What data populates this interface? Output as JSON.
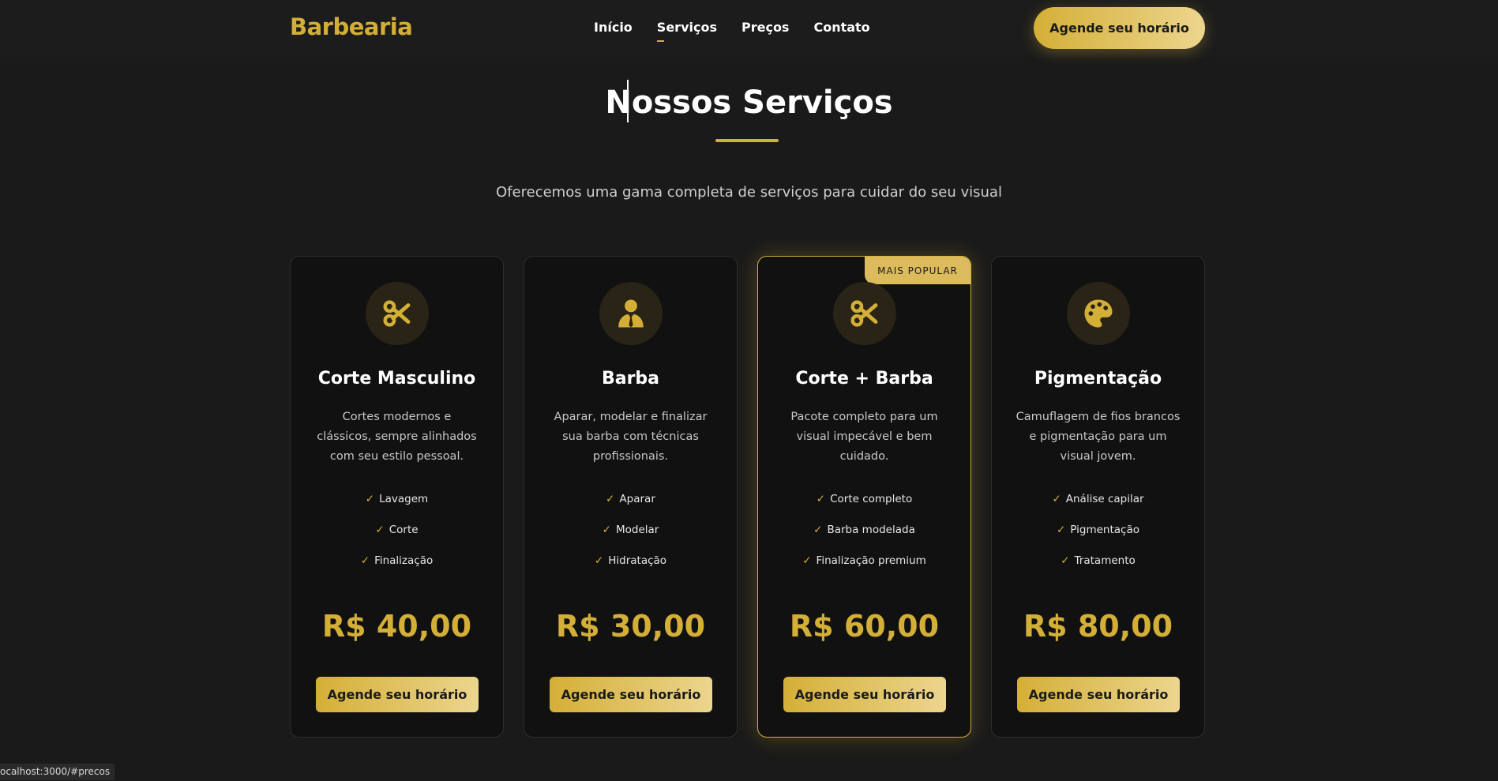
{
  "header": {
    "brand": "Barbearia",
    "nav": [
      "Início",
      "Serviços",
      "Preços",
      "Contato"
    ],
    "active_nav": "Serviços",
    "cta_label": "Agende seu horário"
  },
  "section": {
    "title": "Nossos Serviços",
    "subtitle": "Oferecemos uma gama completa de serviços para cuidar do seu visual"
  },
  "cards": [
    {
      "icon": "scissors-icon",
      "title": "Corte Masculino",
      "description": "Cortes modernos e clássicos, sempre alinhados com seu estilo pessoal.",
      "features": [
        "Lavagem",
        "Corte",
        "Finalização"
      ],
      "price": "R$ 40,00",
      "cta": "Agende seu horário",
      "badge": ""
    },
    {
      "icon": "user-tie-icon",
      "title": "Barba",
      "description": "Aparar, modelar e finalizar sua barba com técnicas profissionais.",
      "features": [
        "Aparar",
        "Modelar",
        "Hidratação"
      ],
      "price": "R$ 30,00",
      "cta": "Agende seu horário",
      "badge": ""
    },
    {
      "icon": "scissors-icon",
      "title": "Corte + Barba",
      "description": "Pacote completo para um visual impecável e bem cuidado.",
      "features": [
        "Corte completo",
        "Barba modelada",
        "Finalização premium"
      ],
      "price": "R$ 60,00",
      "cta": "Agende seu horário",
      "badge": "MAIS POPULAR"
    },
    {
      "icon": "palette-icon",
      "title": "Pigmentação",
      "description": "Camuflagem de fios brancos e pigmentação para um visual jovem.",
      "features": [
        "Análise capilar",
        "Pigmentação",
        "Tratamento"
      ],
      "price": "R$ 80,00",
      "cta": "Agende seu horário",
      "badge": ""
    }
  ],
  "check_glyph": "✓",
  "status_bar": {
    "url": "ocalhost:3000/#precos"
  },
  "colors": {
    "accent": "#d4af37",
    "background": "#1a1a1a",
    "card_background": "#111111"
  }
}
